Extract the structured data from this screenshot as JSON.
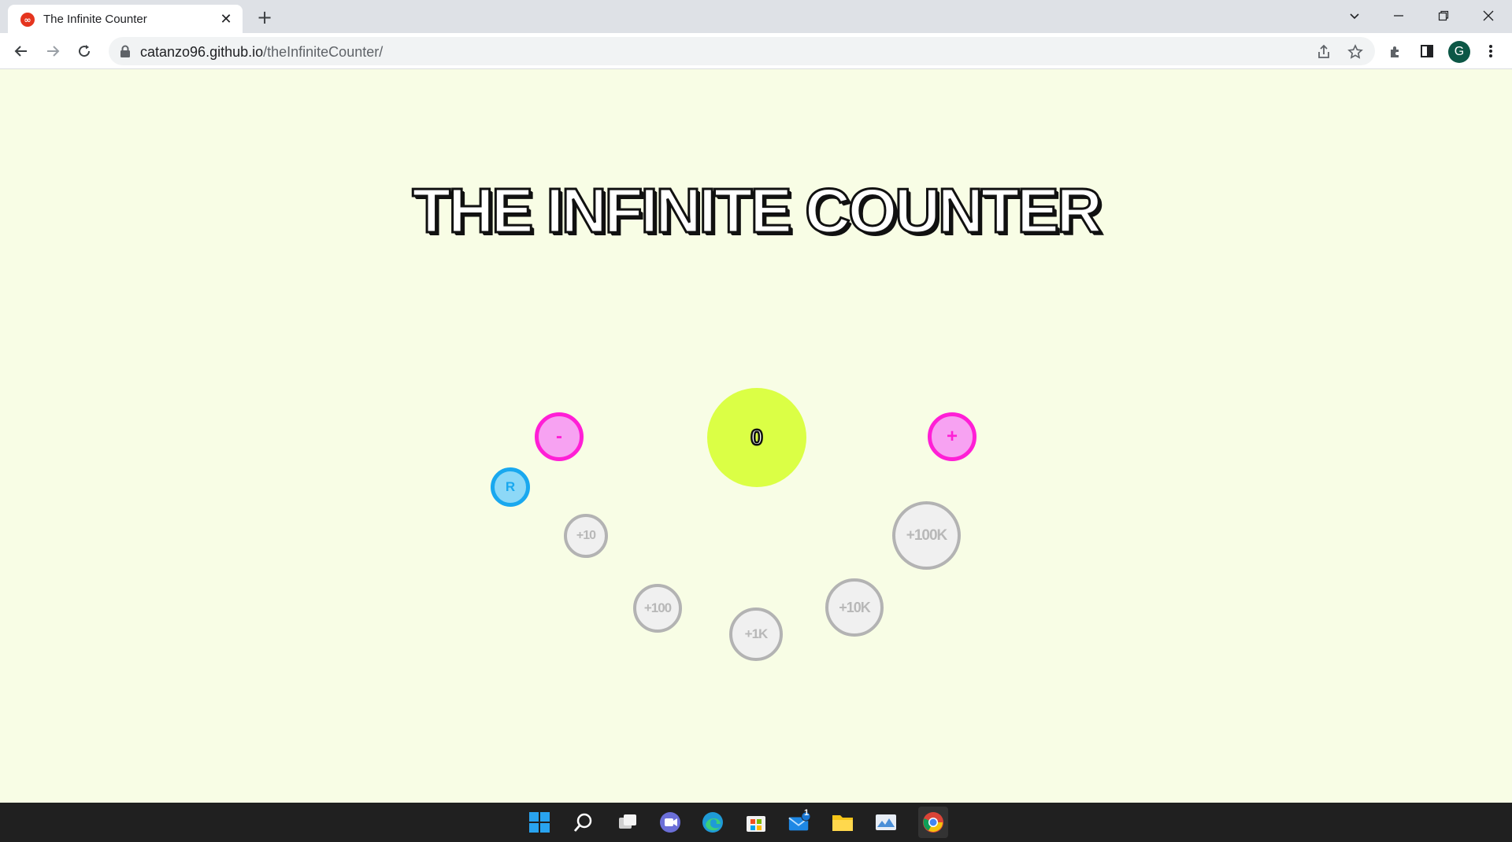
{
  "browser": {
    "tab_title": "The Infinite Counter",
    "favicon_text": "∞",
    "tab_close": "✕",
    "new_tab": "+",
    "url_host": "catanzo96.github.io",
    "url_path": "/theInfiniteCounter/",
    "profile_initial": "G",
    "icons": [
      "tab-search-icon",
      "minimize-icon",
      "restore-icon",
      "close-window-icon",
      "back-icon",
      "forward-icon",
      "reload-icon",
      "lock-icon",
      "share-icon",
      "bookmark-star-icon",
      "extensions-icon",
      "side-panel-icon",
      "menu-icon"
    ]
  },
  "page": {
    "title": "The Infinite Counter",
    "counter_value": "0",
    "decrement_label": "-",
    "increment_label": "+",
    "reset_label": "R",
    "quick_add": [
      {
        "label": "+10"
      },
      {
        "label": "+100"
      },
      {
        "label": "+1K"
      },
      {
        "label": "+10K"
      },
      {
        "label": "+100K"
      }
    ]
  },
  "colors": {
    "page_bg": "#f8fde5",
    "counter_fill": "#dbff45",
    "pink_border": "#ff1fd6",
    "pink_fill": "#f7a2f2",
    "reset_border": "#19a8ef",
    "reset_fill": "#8dd8f7",
    "grey_border": "#b3b3b3",
    "grey_fill": "#f0f0f0"
  },
  "taskbar": {
    "mail_badge": "1",
    "icons": [
      "start-icon",
      "search-icon",
      "task-view-icon",
      "chat-icon",
      "edge-icon",
      "store-icon",
      "mail-icon",
      "file-explorer-icon",
      "photos-icon",
      "chrome-icon"
    ]
  }
}
